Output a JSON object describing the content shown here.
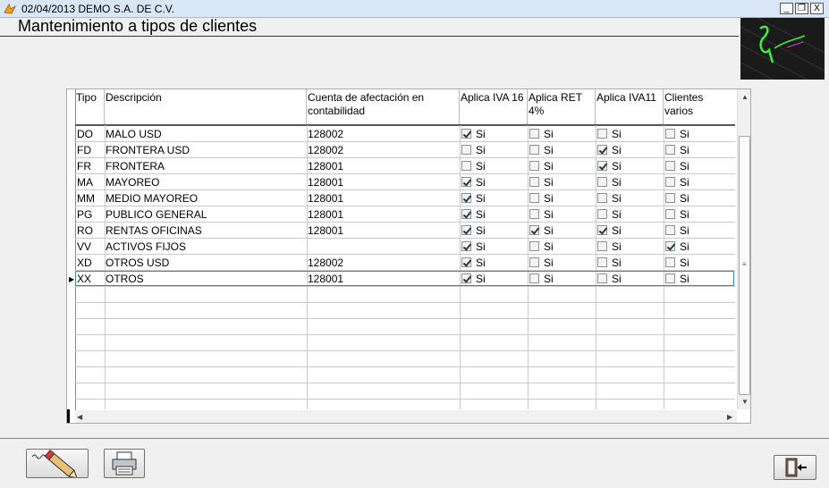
{
  "window": {
    "title": "02/04/2013  DEMO  S.A. DE C.V.",
    "minimize": "_",
    "restore": "❐",
    "close": "X"
  },
  "form": {
    "title": "Mantenimiento a tipos de clientes"
  },
  "grid": {
    "columns": [
      {
        "key": "tipo",
        "label": "Tipo"
      },
      {
        "key": "descripcion",
        "label": "Descripción"
      },
      {
        "key": "cuenta",
        "label": "Cuenta de afectación  en contabilidad"
      },
      {
        "key": "iva16",
        "label": "Aplica IVA 16"
      },
      {
        "key": "ret4",
        "label": "Aplica RET 4%"
      },
      {
        "key": "iva11",
        "label": "Aplica IVA11"
      },
      {
        "key": "varios",
        "label": "Clientes varios"
      }
    ],
    "checkbox_label": "Si",
    "rows": [
      {
        "tipo": "DO",
        "descripcion": "MALO USD",
        "cuenta": "128002",
        "iva16": true,
        "ret4": false,
        "iva11": false,
        "varios": false
      },
      {
        "tipo": "FD",
        "descripcion": "FRONTERA USD",
        "cuenta": "128002",
        "iva16": false,
        "ret4": false,
        "iva11": true,
        "varios": false
      },
      {
        "tipo": "FR",
        "descripcion": "FRONTERA",
        "cuenta": "128001",
        "iva16": false,
        "ret4": false,
        "iva11": true,
        "varios": false
      },
      {
        "tipo": "MA",
        "descripcion": "MAYOREO",
        "cuenta": "128001",
        "iva16": true,
        "ret4": false,
        "iva11": false,
        "varios": false
      },
      {
        "tipo": "MM",
        "descripcion": "MEDIO MAYOREO",
        "cuenta": "128001",
        "iva16": true,
        "ret4": false,
        "iva11": false,
        "varios": false
      },
      {
        "tipo": "PG",
        "descripcion": "PUBLICO GENERAL",
        "cuenta": "128001",
        "iva16": true,
        "ret4": false,
        "iva11": false,
        "varios": false
      },
      {
        "tipo": "RO",
        "descripcion": "RENTAS OFICINAS",
        "cuenta": "128001",
        "iva16": true,
        "ret4": true,
        "iva11": true,
        "varios": false
      },
      {
        "tipo": "VV",
        "descripcion": "ACTIVOS FIJOS",
        "cuenta": "",
        "iva16": true,
        "ret4": false,
        "iva11": false,
        "varios": true
      },
      {
        "tipo": "XD",
        "descripcion": "OTROS USD",
        "cuenta": "128002",
        "iva16": true,
        "ret4": false,
        "iva11": false,
        "varios": false
      },
      {
        "tipo": "XX",
        "descripcion": "OTROS",
        "cuenta": "128001",
        "iva16": true,
        "ret4": false,
        "iva11": false,
        "varios": false
      }
    ],
    "selected_row": 9
  },
  "toolbar": {
    "edit_icon": "pencil-eraser-icon",
    "print_icon": "printer-icon",
    "exit_icon": "exit-door-icon"
  }
}
